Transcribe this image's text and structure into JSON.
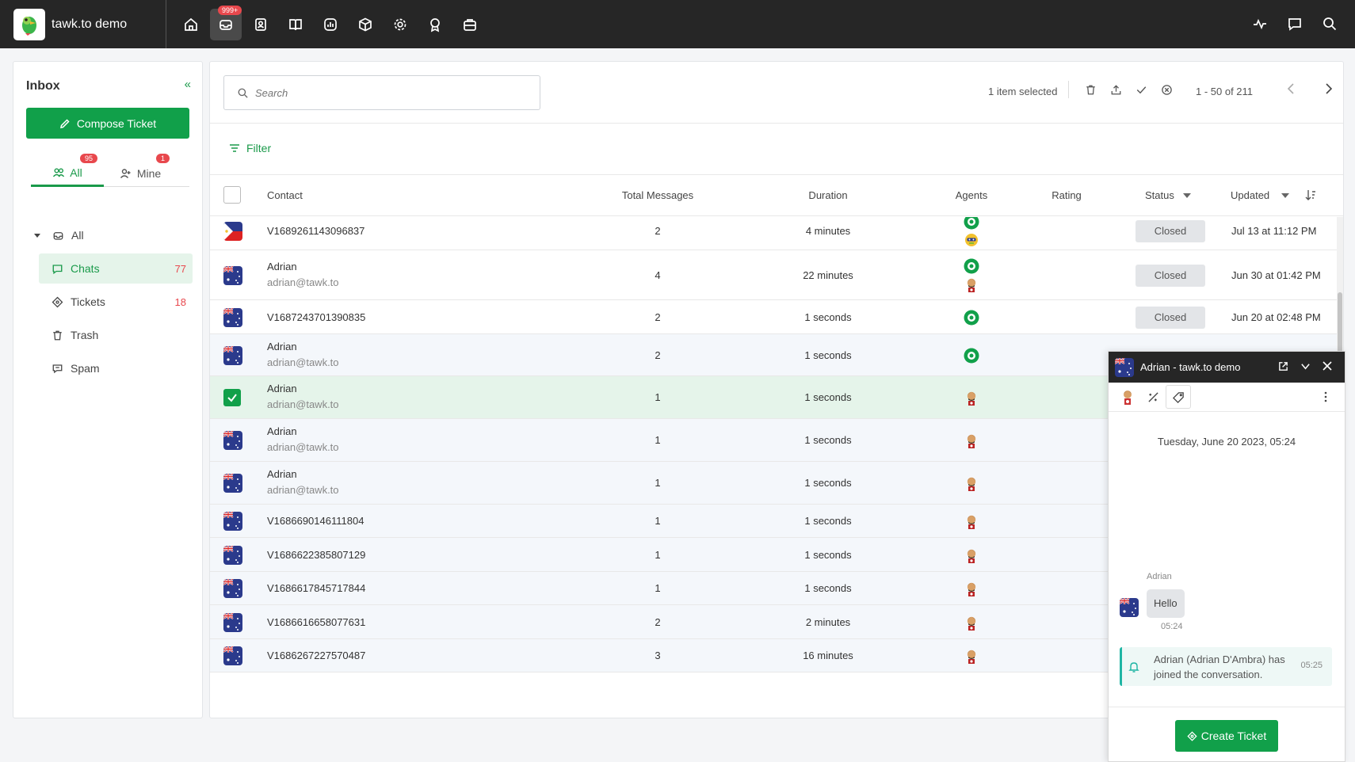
{
  "app": {
    "name": "tawk.to demo",
    "inbox_badge": "999+"
  },
  "sidebar": {
    "title": "Inbox",
    "compose_label": "Compose Ticket",
    "tabs": [
      {
        "label": "All",
        "badge": "95"
      },
      {
        "label": "Mine",
        "badge": "1"
      }
    ],
    "tree": {
      "root_label": "All",
      "items": [
        {
          "label": "Chats",
          "count": "77"
        },
        {
          "label": "Tickets",
          "count": "18"
        },
        {
          "label": "Trash"
        },
        {
          "label": "Spam"
        }
      ]
    }
  },
  "toolbar": {
    "search_placeholder": "Search",
    "selection_info": "1 item selected",
    "pagination": "1 - 50 of 211",
    "filter_label": "Filter"
  },
  "table": {
    "columns": {
      "contact": "Contact",
      "total_messages": "Total Messages",
      "duration": "Duration",
      "agents": "Agents",
      "rating": "Rating",
      "status": "Status",
      "updated": "Updated"
    },
    "rows": [
      {
        "flag": "ph",
        "name": "V1689261143096837",
        "email": "",
        "messages": "2",
        "duration": "4 minutes",
        "agents": [
          "tawk",
          "bot"
        ],
        "status": "Closed",
        "updated": "Jul 13 at 11:12 PM"
      },
      {
        "flag": "au",
        "name": "Adrian",
        "email": "adrian@tawk.to",
        "messages": "4",
        "duration": "22 minutes",
        "agents": [
          "tawk",
          "man"
        ],
        "status": "Closed",
        "updated": "Jun 30 at 01:42 PM"
      },
      {
        "flag": "au",
        "name": "V1687243701390835",
        "email": "",
        "messages": "2",
        "duration": "1 seconds",
        "agents": [
          "tawk"
        ],
        "status": "Closed",
        "updated": "Jun 20 at 02:48 PM"
      },
      {
        "flag": "au",
        "name": "Adrian",
        "email": "adrian@tawk.to",
        "messages": "2",
        "duration": "1 seconds",
        "agents": [
          "tawk"
        ],
        "status": "",
        "updated": ""
      },
      {
        "flag": "au",
        "name": "Adrian",
        "email": "adrian@tawk.to",
        "messages": "1",
        "duration": "1 seconds",
        "agents": [
          "man"
        ],
        "status": "",
        "updated": ""
      },
      {
        "flag": "au",
        "name": "Adrian",
        "email": "adrian@tawk.to",
        "messages": "1",
        "duration": "1 seconds",
        "agents": [
          "man"
        ],
        "status": "",
        "updated": ""
      },
      {
        "flag": "au",
        "name": "Adrian",
        "email": "adrian@tawk.to",
        "messages": "1",
        "duration": "1 seconds",
        "agents": [
          "man"
        ],
        "status": "",
        "updated": ""
      },
      {
        "flag": "au",
        "name": "V1686690146111804",
        "email": "",
        "messages": "1",
        "duration": "1 seconds",
        "agents": [
          "man"
        ],
        "status": "",
        "updated": ""
      },
      {
        "flag": "au",
        "name": "V1686622385807129",
        "email": "",
        "messages": "1",
        "duration": "1 seconds",
        "agents": [
          "man"
        ],
        "status": "",
        "updated": ""
      },
      {
        "flag": "au",
        "name": "V1686617845717844",
        "email": "",
        "messages": "1",
        "duration": "1 seconds",
        "agents": [
          "man"
        ],
        "status": "",
        "updated": ""
      },
      {
        "flag": "au",
        "name": "V1686616658077631",
        "email": "",
        "messages": "2",
        "duration": "2 minutes",
        "agents": [
          "man"
        ],
        "status": "",
        "updated": ""
      },
      {
        "flag": "au",
        "name": "V1686267227570487",
        "email": "",
        "messages": "3",
        "duration": "16 minutes",
        "agents": [
          "man"
        ],
        "status": "",
        "updated": ""
      }
    ]
  },
  "chat_window": {
    "title": "Adrian - tawk.to demo",
    "date": "Tuesday, June 20 2023, 05:24",
    "sender": "Adrian",
    "message": "Hello",
    "message_time": "05:24",
    "system_message": "Adrian (Adrian D'Ambra) has joined the conversation.",
    "system_time": "05:25",
    "create_ticket_label": "Create Ticket"
  },
  "colors": {
    "accent": "#11a04a",
    "topbar": "#262626",
    "badge": "#e8484d",
    "selected_row": "#e5f4ea"
  }
}
